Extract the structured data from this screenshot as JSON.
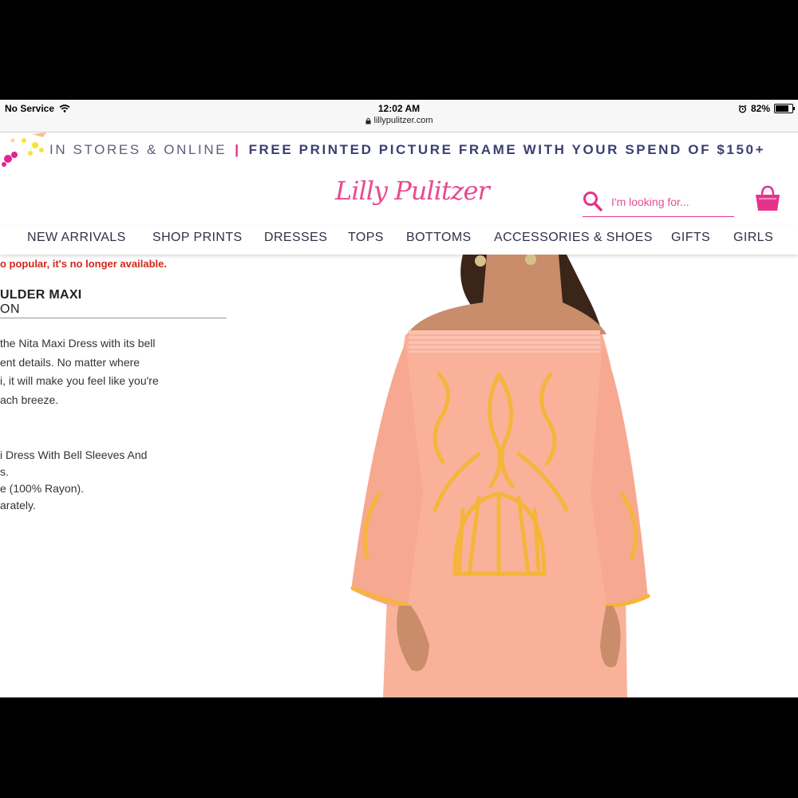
{
  "status_bar": {
    "carrier": "No Service",
    "time": "12:02 AM",
    "url": "lillypulitzer.com",
    "battery": "82%",
    "battery_level": 0.82
  },
  "promo": {
    "part1": "IN STORES & ONLINE",
    "separator": "|",
    "part2": "FREE PRINTED PICTURE FRAME WITH YOUR SPEND OF $150+"
  },
  "header": {
    "logo": "Lilly Pulitzer",
    "search_placeholder": "I'm looking for..."
  },
  "nav": {
    "items": [
      "NEW ARRIVALS",
      "SHOP PRINTS",
      "DRESSES",
      "TOPS",
      "BOTTOMS",
      "ACCESSORIES & SHOES",
      "GIFTS",
      "GIRLS"
    ]
  },
  "product": {
    "notice": "o popular, it's no longer available.",
    "title": "ULDER MAXI",
    "subtitle": "ON",
    "description_lines": [
      "the Nita Maxi Dress with its bell",
      "ent details. No matter where",
      "i, it will make you feel like you're",
      "ach breeze."
    ],
    "detail_lines": [
      "i Dress With Bell Sleeves And",
      "s.",
      "e (100% Rayon).",
      "arately."
    ]
  },
  "colors": {
    "brand_pink": "#e5338b",
    "nav_text": "#2e3249",
    "notice_red": "#d0281c",
    "dress_coral": "#f9b19a",
    "embroidery": "#f5b53a"
  }
}
